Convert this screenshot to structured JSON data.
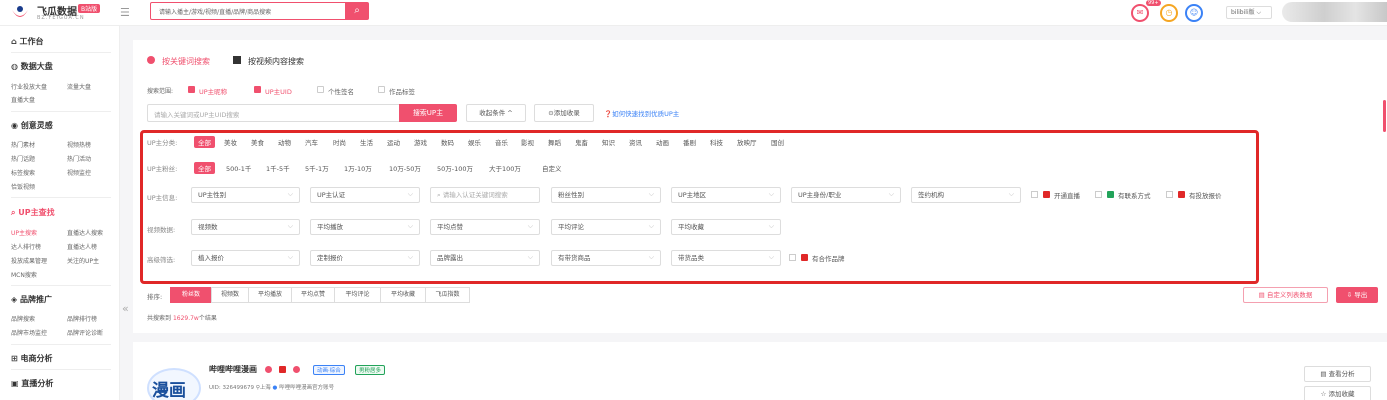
{
  "header": {
    "logo_title": "飞瓜数据",
    "logo_badge": "B站版",
    "logo_sub": "BZ.FEIGUA.CN",
    "search_placeholder": "请输入播主/游戏/视频/直播/品牌/商品搜索",
    "message_badge": "99+",
    "platform": "bilibili版"
  },
  "sidebar": {
    "workbench": "工作台",
    "dashboard": {
      "title": "数据大盘",
      "items": [
        "行业投放大盘",
        "流量大盘",
        "直播大盘"
      ]
    },
    "creative": {
      "title": "创意灵感",
      "items": [
        "热门素材",
        "视频热榜",
        "热门话题",
        "热门活动",
        "标签搜索",
        "视频监控",
        "恰饭视频"
      ]
    },
    "up_search": {
      "title": "UP主查找",
      "items": [
        "UP主搜索",
        "直播达人搜索",
        "达人排行榜",
        "直播达人榜",
        "投放成果管理",
        "关注的UP主",
        "MCN搜索"
      ]
    },
    "brand": {
      "title": "品牌推广",
      "items": [
        "品牌搜索",
        "品牌排行榜",
        "品牌市场监控",
        "品牌评论诊断"
      ]
    },
    "ecommerce": "电商分析",
    "live": "直播分析"
  },
  "main": {
    "tabs": [
      "按关键词搜索",
      "按视频内容搜索"
    ],
    "search_range_label": "搜索范围:",
    "search_range": [
      {
        "label": "UP主昵称",
        "checked": true
      },
      {
        "label": "UP主UID",
        "checked": true
      },
      {
        "label": "个性签名",
        "checked": false
      },
      {
        "label": "作品标签",
        "checked": false
      }
    ],
    "keyword_placeholder": "请输入关键词或UP主UID搜索",
    "search_button": "搜索UP主",
    "filter_toggle": "收起条件 ^",
    "add_collection": "⊙添加收录",
    "help_link": "如何快速找到优质UP主",
    "filters": {
      "category_label": "UP主分类:",
      "categories": [
        "全部",
        "美妆",
        "美食",
        "动物",
        "汽车",
        "时尚",
        "生活",
        "运动",
        "游戏",
        "数码",
        "娱乐",
        "音乐",
        "影视",
        "舞蹈",
        "鬼畜",
        "知识",
        "资讯",
        "动画",
        "番剧",
        "科技",
        "放映厅",
        "国创"
      ],
      "fans_label": "UP主粉丝:",
      "fans": [
        "全部",
        "500-1千",
        "1千-5千",
        "5千-1万",
        "1万-10万",
        "10万-50万",
        "50万-100万",
        "大于100万",
        "自定义"
      ],
      "info_label": "UP主信息:",
      "info_selects": [
        "UP主性别",
        "UP主认证",
        "请输入认证关键词搜索",
        "粉丝性别",
        "UP主地区",
        "UP主身份/职业",
        "签约机构"
      ],
      "info_options": [
        "开通直播",
        "有联系方式",
        "有投放报价"
      ],
      "video_label": "视频数据:",
      "video_selects": [
        "视频数",
        "平均播放",
        "平均点赞",
        "平均评论",
        "平均收藏"
      ],
      "advanced_label": "高级筛选:",
      "advanced_selects": [
        "植入报价",
        "定制报价",
        "品牌露出",
        "有带货商品",
        "带货品类"
      ],
      "advanced_options": [
        "有合作品牌"
      ]
    },
    "sort_label": "排序:",
    "sort_tabs": [
      "粉丝数",
      "视频数",
      "平均播放",
      "平均点赞",
      "平均评论",
      "平均收藏",
      "飞瓜指数"
    ],
    "custom_button": "自定义列表数据",
    "export_button": "导出",
    "total_prefix": "共搜索到",
    "total_count": "1629.7w",
    "total_suffix": "个结果"
  },
  "result": {
    "avatar_text": "漫画",
    "name": "哔哩哔哩漫画",
    "tags": [
      "动画·综合",
      "男粉居多"
    ],
    "uid": "UID: 326499679",
    "location": "上海",
    "verify": "哔哩哔哩漫画官方账号",
    "buttons": [
      "查看分析",
      "添加收藏"
    ]
  },
  "colors": {
    "accent": "#f0506e",
    "highlight_box": "#e02828",
    "link": "#3b82f6"
  }
}
